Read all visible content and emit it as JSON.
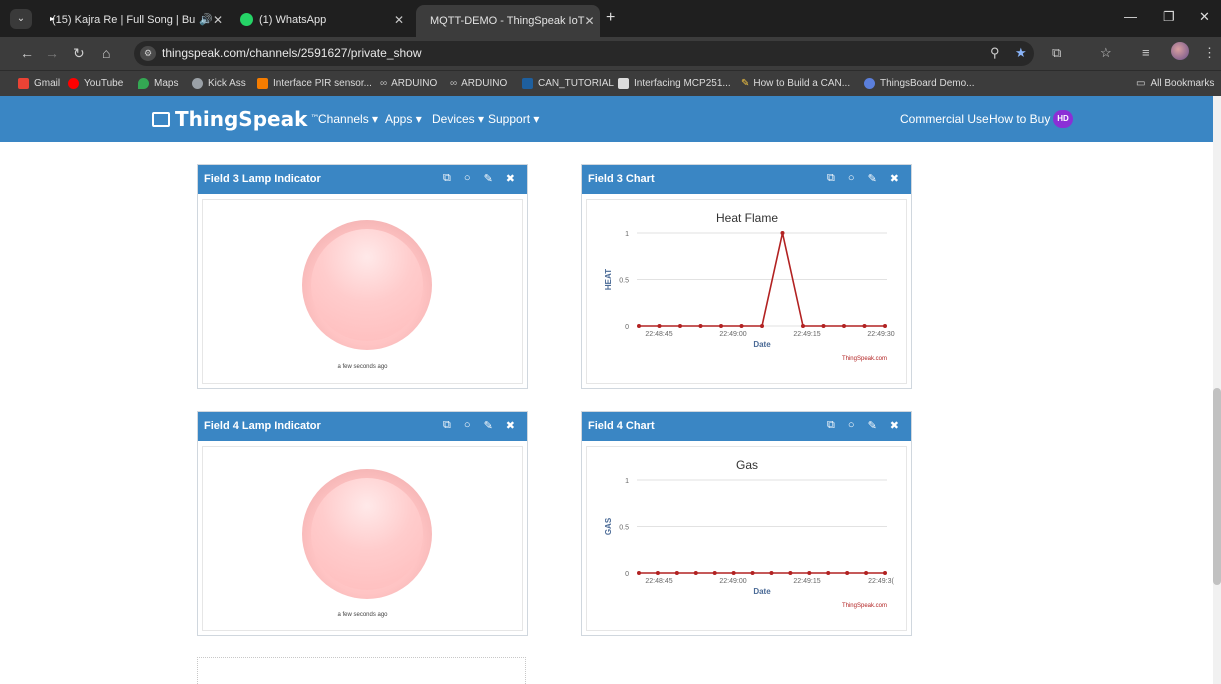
{
  "browser": {
    "tabs": [
      {
        "title": "(15) Kajra Re | Full Song | Bu",
        "icon": "youtube-icon"
      },
      {
        "title": "(1) WhatsApp",
        "icon": "whatsapp-icon"
      },
      {
        "title": "MQTT-DEMO - ThingSpeak IoT",
        "icon": "thingspeak-icon"
      }
    ],
    "url": "thingspeak.com/channels/2591627/private_show",
    "bookmarks": [
      "Gmail",
      "YouTube",
      "Maps",
      "Kick Ass",
      "Interface PIR sensor...",
      "ARDUINO",
      "ARDUINO",
      "CAN_TUTORIAL",
      "Interfacing MCP251...",
      "How to Build a CAN...",
      "ThingsBoard Demo..."
    ],
    "all_bookmarks": "All Bookmarks"
  },
  "navbar": {
    "logo": "ThingSpeak",
    "trademark": "™",
    "menu": [
      "Channels",
      "Apps",
      "Devices",
      "Support"
    ],
    "commercial": "Commercial Use",
    "how_to_buy": "How to Buy",
    "user_initials": "HD"
  },
  "widgets": {
    "field3_lamp": {
      "title": "Field 3 Lamp Indicator",
      "timestamp": "a few seconds ago",
      "lamp_color": "#ffc4c4"
    },
    "field3_chart": {
      "title": "Field 3 Chart",
      "credit": "ThingSpeak.com"
    },
    "field4_lamp": {
      "title": "Field 4 Lamp Indicator",
      "timestamp": "a few seconds ago",
      "lamp_color": "#ffc4c4"
    },
    "field4_chart": {
      "title": "Field 4 Chart",
      "credit": "ThingSpeak.com"
    }
  },
  "chart_data": [
    {
      "type": "line",
      "title": "Heat Flame",
      "xlabel": "Date",
      "ylabel": "HEAT",
      "ylim": [
        0,
        1
      ],
      "yticks": [
        "0",
        "0.5",
        "1"
      ],
      "xticks": [
        "22:48:45",
        "22:49:00",
        "22:49:15",
        "22:49:30"
      ],
      "series": [
        {
          "values": [
            0,
            0,
            0,
            0,
            0,
            0,
            0,
            1,
            0,
            0,
            0,
            0,
            0
          ]
        }
      ],
      "color": "#b22222",
      "grid": true
    },
    {
      "type": "line",
      "title": "Gas",
      "xlabel": "Date",
      "ylabel": "GAS",
      "ylim": [
        0,
        1
      ],
      "yticks": [
        "0",
        "0.5",
        "1"
      ],
      "xticks": [
        "22:48:45",
        "22:49:00",
        "22:49:15",
        "22:49:3("
      ],
      "series": [
        {
          "values": [
            0,
            0,
            0,
            0,
            0,
            0,
            0,
            0,
            0,
            0,
            0,
            0,
            0,
            0
          ]
        }
      ],
      "color": "#b22222",
      "grid": true
    }
  ]
}
